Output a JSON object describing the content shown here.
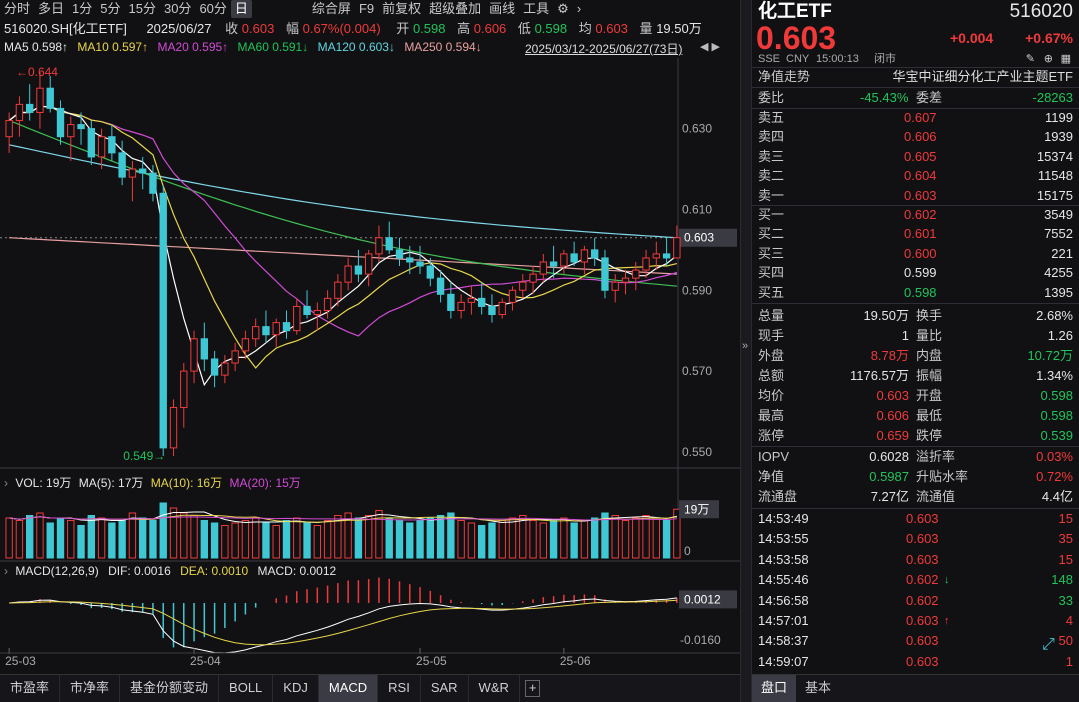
{
  "toolbar": {
    "tabs": [
      "分时",
      "多日",
      "1分",
      "5分",
      "15分",
      "30分",
      "60分",
      "日"
    ],
    "active": "日",
    "right_tabs": [
      "综合屏",
      "F9",
      "前复权",
      "超级叠加",
      "画线",
      "工具"
    ]
  },
  "quote_bar": {
    "code": "516020.SH[化工ETF]",
    "date": "2025/06/27",
    "close_label": "收",
    "close": "0.603",
    "change_label": "幅",
    "change": "0.67%(0.004)",
    "open_label": "开",
    "open": "0.598",
    "high_label": "高",
    "high": "0.606",
    "low_label": "低",
    "low": "0.598",
    "avg_label": "均",
    "avg": "0.603",
    "vol_label": "量",
    "vol": "19.50万"
  },
  "ma": {
    "ma5": "MA5  0.598↑",
    "ma10": "MA10  0.597↑",
    "ma20": "MA20  0.595↑",
    "ma60": "MA60  0.591↓",
    "ma120": "MA120  0.603↓",
    "ma250": "MA250  0.594↓"
  },
  "range": "2025/03/12-2025/06/27(73日)",
  "colors": {
    "up": "#f03a3a",
    "down": "#3fc8d4",
    "ma5": "#ffffff",
    "ma10": "#e8d64a",
    "ma20": "#d24bd4",
    "ma60": "#3fbf52",
    "ma120": "#7fd8ea",
    "ma250": "#e8a0a0"
  },
  "price_axis": {
    "labels": [
      "0.630",
      "0.610",
      "0.590",
      "0.570",
      "0.550"
    ],
    "current": "0.603",
    "max_label": "0.644",
    "min_label": "0.549"
  },
  "date_axis": [
    "25-03",
    "25-04",
    "25-05",
    "25-06"
  ],
  "vol": {
    "label": "VOL: 19万",
    "ma5": "MA(5): 17万",
    "ma10": "MA(10): 16万",
    "ma20": "MA(20): 15万",
    "current": "19万",
    "zero": "0"
  },
  "macd": {
    "label": "MACD(12,26,9)",
    "dif": "DIF: 0.0016",
    "dea": "DEA: 0.0010",
    "macd": "MACD: 0.0012",
    "current": "0.0012",
    "low": "-0.0160"
  },
  "bottom_tabs": [
    "市盈率",
    "市净率",
    "基金份额变动",
    "BOLL",
    "KDJ",
    "MACD",
    "RSI",
    "SAR",
    "W&R"
  ],
  "bottom_active": "MACD",
  "right": {
    "name": "化工ETF",
    "code": "516020",
    "price": "0.603",
    "chg": "+0.004",
    "pct": "+0.67%",
    "market": "SSE",
    "currency": "CNY",
    "time": "15:00:13",
    "status": "闭市",
    "nav_trend": "净值走势",
    "full_name": "华宝中证细分化工产业主题ETF",
    "wb_label": "委比",
    "wb": "-45.43%",
    "wc_label": "委差",
    "wc": "-28263",
    "asks": [
      {
        "l": "卖五",
        "p": "0.607",
        "v": "1199"
      },
      {
        "l": "卖四",
        "p": "0.606",
        "v": "1939"
      },
      {
        "l": "卖三",
        "p": "0.605",
        "v": "15374"
      },
      {
        "l": "卖二",
        "p": "0.604",
        "v": "11548"
      },
      {
        "l": "卖一",
        "p": "0.603",
        "v": "15175"
      }
    ],
    "bids": [
      {
        "l": "买一",
        "p": "0.602",
        "v": "3549"
      },
      {
        "l": "买二",
        "p": "0.601",
        "v": "7552"
      },
      {
        "l": "买三",
        "p": "0.600",
        "v": "221"
      },
      {
        "l": "买四",
        "p": "0.599",
        "v": "4255"
      },
      {
        "l": "买五",
        "p": "0.598",
        "v": "1395"
      }
    ],
    "stats": [
      {
        "l1": "总量",
        "v1": "19.50万",
        "l2": "换手",
        "v2": "2.68%",
        "c1": "wht",
        "c2": "wht"
      },
      {
        "l1": "现手",
        "v1": "1",
        "l2": "量比",
        "v2": "1.26",
        "c1": "wht",
        "c2": "wht"
      },
      {
        "l1": "外盘",
        "v1": "8.78万",
        "l2": "内盘",
        "v2": "10.72万",
        "c1": "red",
        "c2": "grn"
      },
      {
        "l1": "总额",
        "v1": "1176.57万",
        "l2": "振幅",
        "v2": "1.34%",
        "c1": "wht",
        "c2": "wht"
      },
      {
        "l1": "均价",
        "v1": "0.603",
        "l2": "开盘",
        "v2": "0.598",
        "c1": "red",
        "c2": "grn"
      },
      {
        "l1": "最高",
        "v1": "0.606",
        "l2": "最低",
        "v2": "0.598",
        "c1": "red",
        "c2": "grn"
      },
      {
        "l1": "涨停",
        "v1": "0.659",
        "l2": "跌停",
        "v2": "0.539",
        "c1": "red",
        "c2": "grn"
      }
    ],
    "iopv": [
      {
        "l1": "IOPV",
        "v1": "0.6028",
        "l2": "溢折率",
        "v2": "0.03%",
        "c1": "wht",
        "c2": "red"
      },
      {
        "l1": "净值",
        "v1": "0.5987",
        "l2": "升贴水率",
        "v2": "0.72%",
        "c1": "grn",
        "c2": "red"
      },
      {
        "l1": "流通盘",
        "v1": "7.27亿",
        "l2": "流通值",
        "v2": "4.4亿",
        "c1": "wht",
        "c2": "wht"
      }
    ],
    "ticks": [
      {
        "t": "14:53:49",
        "p": "0.603",
        "v": "15",
        "pc": "red",
        "vc": "red",
        "a": ""
      },
      {
        "t": "14:53:55",
        "p": "0.603",
        "v": "35",
        "pc": "red",
        "vc": "red",
        "a": ""
      },
      {
        "t": "14:53:58",
        "p": "0.603",
        "v": "15",
        "pc": "red",
        "vc": "red",
        "a": ""
      },
      {
        "t": "14:55:46",
        "p": "0.602",
        "v": "148",
        "pc": "red",
        "vc": "grn",
        "a": "↓"
      },
      {
        "t": "14:56:58",
        "p": "0.602",
        "v": "33",
        "pc": "red",
        "vc": "grn",
        "a": ""
      },
      {
        "t": "14:57:01",
        "p": "0.603",
        "v": "4",
        "pc": "red",
        "vc": "red",
        "a": "↑"
      },
      {
        "t": "14:58:37",
        "p": "0.603",
        "v": "50",
        "pc": "red",
        "vc": "red",
        "a": ""
      },
      {
        "t": "14:59:07",
        "p": "0.603",
        "v": "1",
        "pc": "red",
        "vc": "red",
        "a": ""
      }
    ],
    "tabs": [
      "盘口",
      "基本"
    ],
    "tab_active": "盘口"
  },
  "chart_data": {
    "type": "candlestick",
    "x_range": [
      "2025/03/12",
      "2025/06/27"
    ],
    "y_range": [
      0.548,
      0.645
    ],
    "ohlc": [
      [
        0.628,
        0.634,
        0.624,
        0.632
      ],
      [
        0.632,
        0.638,
        0.628,
        0.636
      ],
      [
        0.636,
        0.641,
        0.632,
        0.634
      ],
      [
        0.634,
        0.644,
        0.63,
        0.64
      ],
      [
        0.64,
        0.643,
        0.634,
        0.635
      ],
      [
        0.635,
        0.637,
        0.626,
        0.628
      ],
      [
        0.628,
        0.633,
        0.622,
        0.631
      ],
      [
        0.631,
        0.634,
        0.626,
        0.63
      ],
      [
        0.63,
        0.632,
        0.621,
        0.623
      ],
      [
        0.623,
        0.63,
        0.62,
        0.628
      ],
      [
        0.628,
        0.631,
        0.622,
        0.624
      ],
      [
        0.624,
        0.627,
        0.616,
        0.618
      ],
      [
        0.618,
        0.622,
        0.612,
        0.62
      ],
      [
        0.62,
        0.623,
        0.615,
        0.619
      ],
      [
        0.619,
        0.621,
        0.612,
        0.614
      ],
      [
        0.614,
        0.616,
        0.549,
        0.551
      ],
      [
        0.551,
        0.563,
        0.549,
        0.561
      ],
      [
        0.561,
        0.572,
        0.556,
        0.57
      ],
      [
        0.57,
        0.58,
        0.567,
        0.578
      ],
      [
        0.578,
        0.582,
        0.57,
        0.573
      ],
      [
        0.573,
        0.575,
        0.566,
        0.569
      ],
      [
        0.569,
        0.574,
        0.567,
        0.572
      ],
      [
        0.572,
        0.577,
        0.57,
        0.575
      ],
      [
        0.575,
        0.58,
        0.573,
        0.578
      ],
      [
        0.578,
        0.583,
        0.576,
        0.581
      ],
      [
        0.581,
        0.585,
        0.577,
        0.579
      ],
      [
        0.579,
        0.583,
        0.576,
        0.582
      ],
      [
        0.582,
        0.585,
        0.578,
        0.58
      ],
      [
        0.58,
        0.588,
        0.579,
        0.586
      ],
      [
        0.586,
        0.59,
        0.583,
        0.584
      ],
      [
        0.584,
        0.587,
        0.58,
        0.585
      ],
      [
        0.585,
        0.59,
        0.583,
        0.588
      ],
      [
        0.588,
        0.594,
        0.586,
        0.592
      ],
      [
        0.592,
        0.598,
        0.59,
        0.596
      ],
      [
        0.596,
        0.6,
        0.592,
        0.594
      ],
      [
        0.594,
        0.6,
        0.591,
        0.599
      ],
      [
        0.599,
        0.606,
        0.597,
        0.603
      ],
      [
        0.603,
        0.607,
        0.599,
        0.6
      ],
      [
        0.6,
        0.603,
        0.596,
        0.598
      ],
      [
        0.598,
        0.601,
        0.594,
        0.597
      ],
      [
        0.597,
        0.601,
        0.594,
        0.596
      ],
      [
        0.596,
        0.598,
        0.591,
        0.593
      ],
      [
        0.593,
        0.595,
        0.587,
        0.589
      ],
      [
        0.589,
        0.592,
        0.583,
        0.585
      ],
      [
        0.585,
        0.589,
        0.583,
        0.587
      ],
      [
        0.587,
        0.591,
        0.584,
        0.588
      ],
      [
        0.588,
        0.592,
        0.584,
        0.586
      ],
      [
        0.586,
        0.589,
        0.582,
        0.584
      ],
      [
        0.584,
        0.588,
        0.583,
        0.587
      ],
      [
        0.587,
        0.591,
        0.585,
        0.59
      ],
      [
        0.59,
        0.594,
        0.588,
        0.592
      ],
      [
        0.592,
        0.596,
        0.589,
        0.594
      ],
      [
        0.594,
        0.599,
        0.592,
        0.597
      ],
      [
        0.597,
        0.601,
        0.593,
        0.596
      ],
      [
        0.596,
        0.6,
        0.594,
        0.599
      ],
      [
        0.599,
        0.602,
        0.596,
        0.597
      ],
      [
        0.597,
        0.601,
        0.594,
        0.6
      ],
      [
        0.6,
        0.603,
        0.596,
        0.598
      ],
      [
        0.598,
        0.6,
        0.588,
        0.59
      ],
      [
        0.59,
        0.594,
        0.587,
        0.592
      ],
      [
        0.592,
        0.595,
        0.589,
        0.593
      ],
      [
        0.593,
        0.597,
        0.59,
        0.595
      ],
      [
        0.595,
        0.6,
        0.593,
        0.598
      ],
      [
        0.598,
        0.602,
        0.595,
        0.599
      ],
      [
        0.599,
        0.603,
        0.596,
        0.598
      ],
      [
        0.598,
        0.606,
        0.598,
        0.603
      ]
    ],
    "volume_wan": [
      16,
      15,
      17,
      18,
      14,
      16,
      15,
      13,
      17,
      16,
      14,
      15,
      18,
      16,
      15,
      22,
      20,
      18,
      17,
      15,
      14,
      13,
      14,
      15,
      16,
      14,
      13,
      15,
      16,
      14,
      13,
      15,
      17,
      18,
      16,
      17,
      19,
      16,
      15,
      14,
      15,
      16,
      17,
      18,
      15,
      14,
      13,
      14,
      15,
      16,
      17,
      15,
      14,
      15,
      16,
      14,
      15,
      16,
      18,
      17,
      15,
      16,
      17,
      16,
      15,
      19.5
    ],
    "ma5_last": 0.598,
    "ma10_last": 0.597,
    "ma20_last": 0.595,
    "ma60_last": 0.591,
    "ma120_last": 0.603,
    "ma250_last": 0.594
  }
}
